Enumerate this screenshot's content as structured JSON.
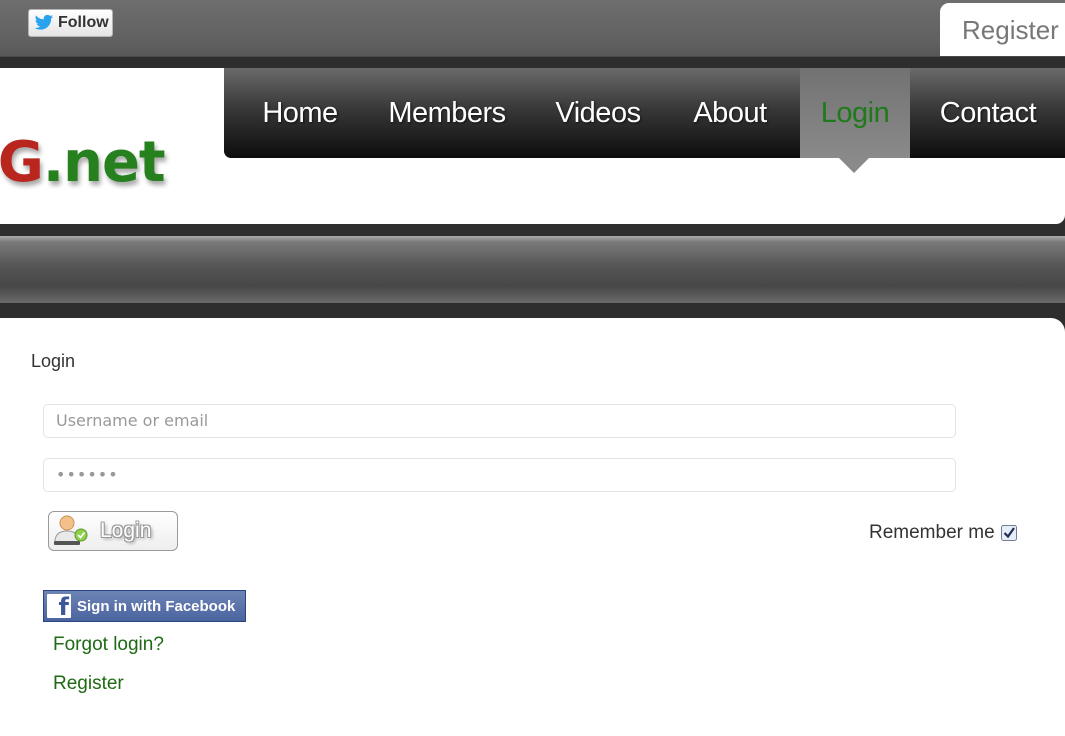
{
  "topbar": {
    "follow_label": "Follow",
    "register_label": "Register"
  },
  "logo": {
    "part1": "JG",
    "part2": ".net"
  },
  "nav": {
    "items": [
      {
        "label": "Home"
      },
      {
        "label": "Members"
      },
      {
        "label": "Videos"
      },
      {
        "label": "About"
      },
      {
        "label": "Login",
        "active": true
      },
      {
        "label": "Contact"
      }
    ]
  },
  "login": {
    "title": "Login",
    "username_placeholder": "Username or email",
    "password_value": "••••••",
    "login_button": "Login",
    "remember_label": "Remember me",
    "remember_checked": true,
    "facebook_button": "Sign in with Facebook",
    "forgot_link": "Forgot login?",
    "register_link": "Register"
  },
  "colors": {
    "active_nav_text": "#1f7a1a",
    "link": "#1d6a12",
    "logo_red": "#b8261e",
    "logo_green": "#25801d",
    "facebook_blue": "#4a64a0"
  }
}
